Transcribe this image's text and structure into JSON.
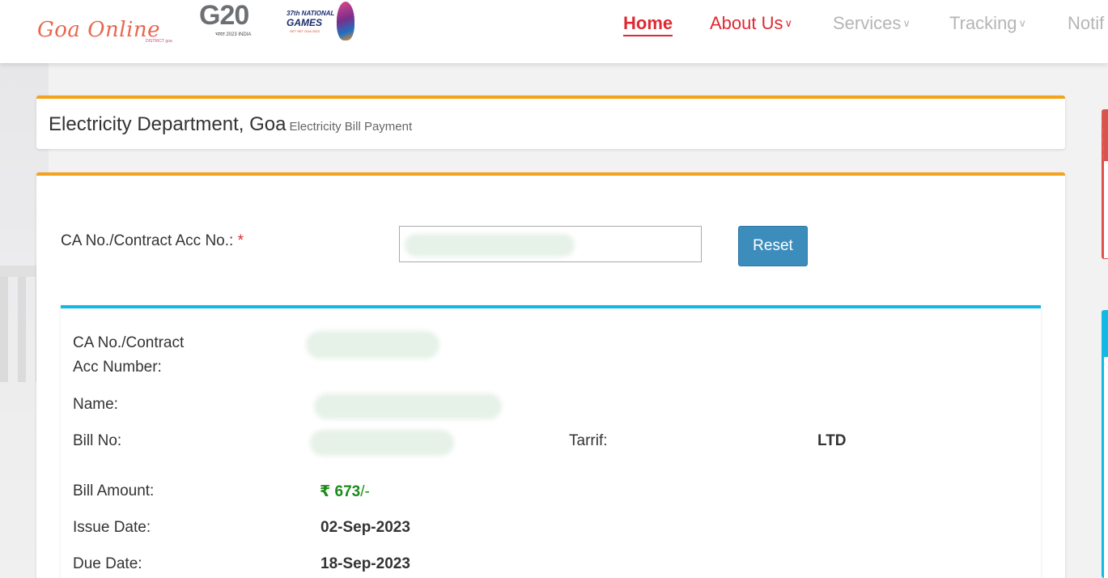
{
  "header": {
    "brand": "Goa Online",
    "brand_sub": "DISTRICT goa",
    "g20_logo": "G20",
    "g20_sub": "भारत 2023 INDIA",
    "games_logo": {
      "line1": "37th NATIONAL",
      "line2": "GAMES",
      "line3": "GET SET GOA 2023"
    },
    "nav": [
      {
        "label": "Home",
        "state": "active"
      },
      {
        "label": "About Us",
        "state": "normal"
      },
      {
        "label": "Services",
        "state": "disabled"
      },
      {
        "label": "Tracking",
        "state": "disabled"
      },
      {
        "label": "Notif",
        "state": "disabled"
      }
    ]
  },
  "page": {
    "department": "Electricity Department, Goa",
    "subtitle": "Electricity Bill Payment"
  },
  "form": {
    "ca_label": "CA No./Contract Acc No.:",
    "required_mark": "*",
    "ca_value": "",
    "reset_label": "Reset"
  },
  "details": {
    "ca_number_label_line1": "CA No./Contract",
    "ca_number_label_line2": "Acc Number:",
    "name_label": "Name:",
    "bill_no_label": "Bill No:",
    "tariff_label": "Tarrif:",
    "tariff_value": "LTD",
    "bill_amount_label": "Bill Amount:",
    "bill_amount_symbol": "₹",
    "bill_amount_value": "673",
    "bill_amount_suffix": "/-",
    "issue_date_label": "Issue Date:",
    "issue_date_value": "02-Sep-2023",
    "due_date_label": "Due Date:",
    "due_date_value": "18-Sep-2023"
  },
  "colors": {
    "accent_red": "#e02832",
    "card_top_orange": "#f4a21a",
    "detail_top_blue": "#13b9e5",
    "button_blue": "#3c8dbc",
    "amount_green": "#1a8c1a"
  }
}
